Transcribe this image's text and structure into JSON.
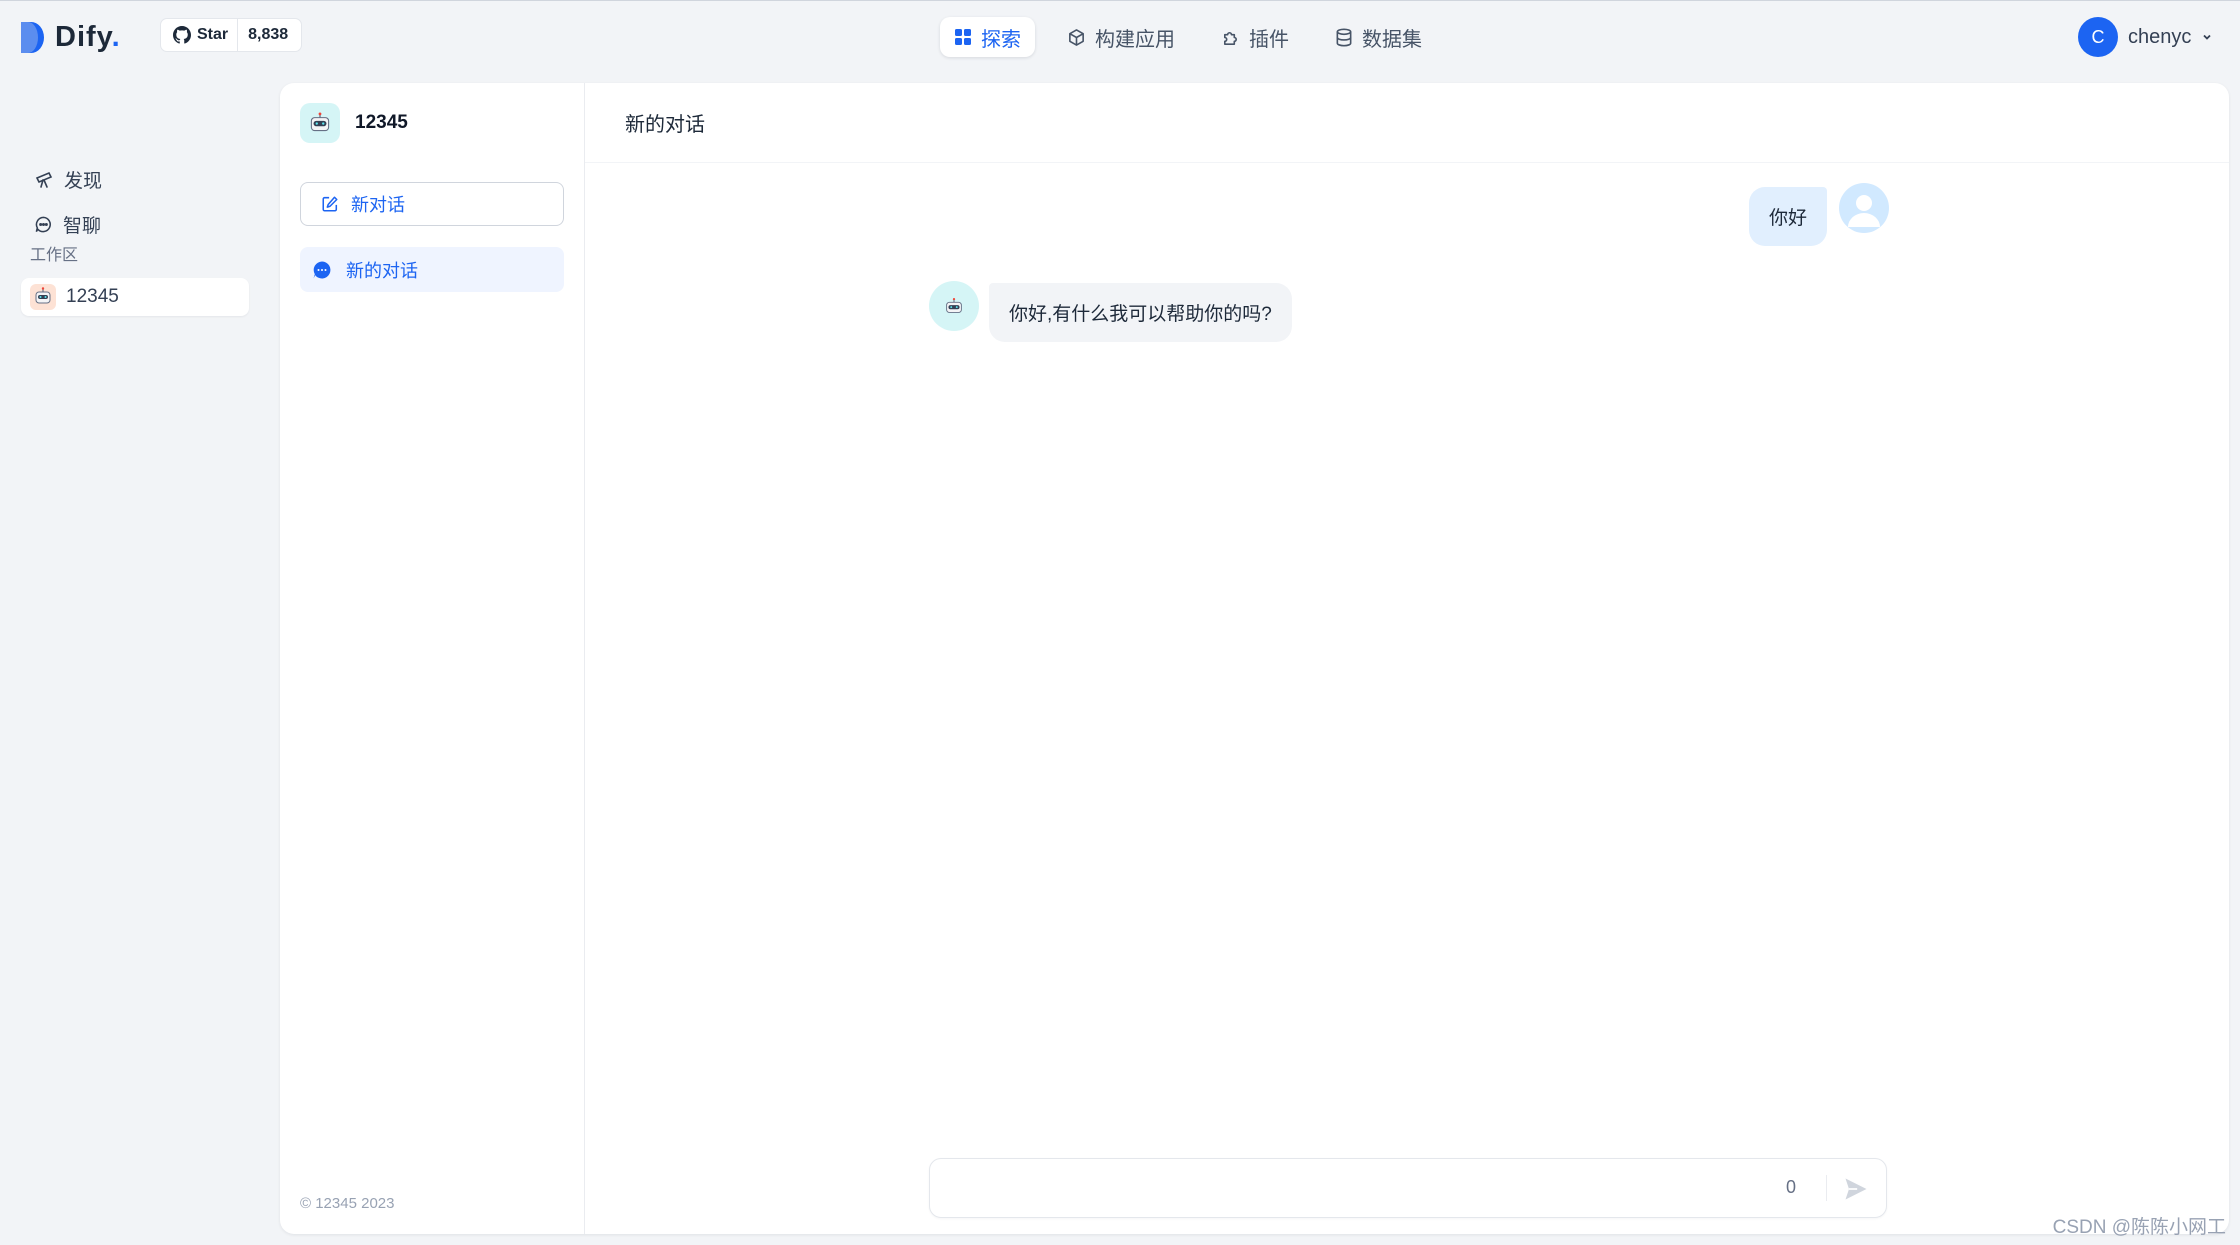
{
  "brand": {
    "name": "Dify",
    "dot": ".",
    "accent": "#1c64f2"
  },
  "github": {
    "star_label": "Star",
    "count": "8,838"
  },
  "nav": [
    {
      "label": "探索",
      "icon": "grid-icon",
      "active": true
    },
    {
      "label": "构建应用",
      "icon": "cube-icon",
      "active": false
    },
    {
      "label": "插件",
      "icon": "puzzle-icon",
      "active": false
    },
    {
      "label": "数据集",
      "icon": "database-icon",
      "active": false
    }
  ],
  "user": {
    "initial": "C",
    "name": "chenyc"
  },
  "sidebar": {
    "items": [
      {
        "label": "发现",
        "icon": "telescope-icon"
      },
      {
        "label": "智聊",
        "icon": "chat-bubble-icon"
      }
    ],
    "section_label": "工作区",
    "workspace_item": "12345"
  },
  "app": {
    "name": "12345",
    "new_chat_label": "新对话",
    "conversations": [
      {
        "title": "新的对话",
        "active": true
      }
    ],
    "copyright": "© 12345 2023"
  },
  "chat": {
    "title": "新的对话",
    "messages": [
      {
        "role": "user",
        "text": "你好"
      },
      {
        "role": "assistant",
        "text": "你好,有什么我可以帮助你的吗?"
      }
    ],
    "input_value": "",
    "char_count": "0"
  },
  "watermark": "CSDN @陈陈小网工"
}
